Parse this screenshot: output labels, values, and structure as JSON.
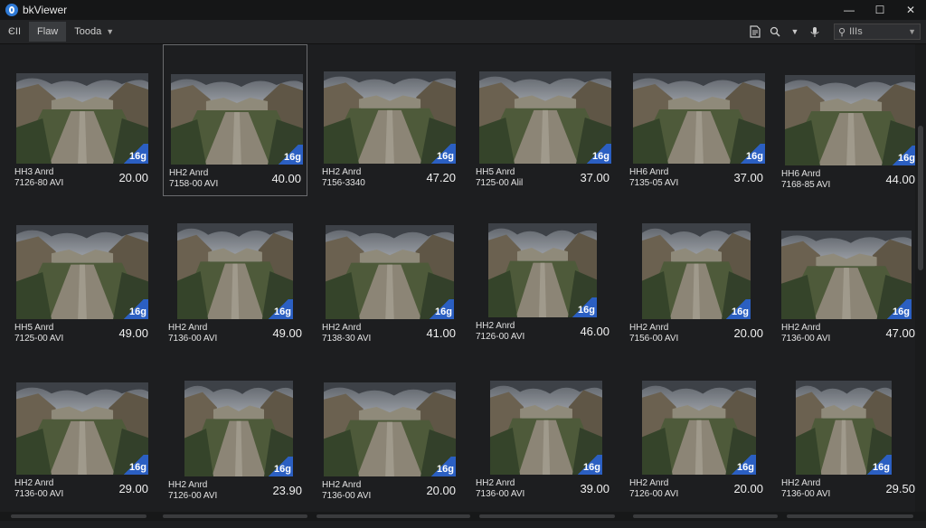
{
  "window": {
    "title": "bkViewer",
    "minimize": "—",
    "maximize": "☐",
    "close": "✕"
  },
  "toolbar": {
    "items": [
      "ЄІІ",
      "Flaw",
      "Tooda"
    ],
    "active_index": 1,
    "filter_label": "IIIs"
  },
  "icons": {
    "app": "app-logo-icon",
    "doc": "document-icon",
    "search": "search-icon",
    "mic": "microphone-icon",
    "filter": "filter-icon"
  },
  "accent_color": "#2b5fc2",
  "cards": [
    {
      "title": "HH3 Anrd",
      "time": "7126-80 AVI",
      "price": "20.00",
      "badge": "16g"
    },
    {
      "title": "HH2 Anrd",
      "time": "7158-00 AVI",
      "price": "40.00",
      "badge": "16g"
    },
    {
      "title": "HH2 Anrd",
      "time": "7156-3340",
      "price": "47.20",
      "badge": "16g"
    },
    {
      "title": "HH5 Anrd",
      "time": "7125-00 Alil",
      "price": "37.00",
      "badge": "16g"
    },
    {
      "title": "HH6 Anrd",
      "time": "7135-05 AVI",
      "price": "37.00",
      "badge": "16g"
    },
    {
      "title": "HH6 Anrd",
      "time": "7168-85 AVI",
      "price": "44.00",
      "badge": "16g"
    },
    {
      "title": "HH5 Anrd",
      "time": "7125-00 AVI",
      "price": "49.00",
      "badge": "16g"
    },
    {
      "title": "HH2 Anrd",
      "time": "7136-00 AVI",
      "price": "49.00",
      "badge": "16g"
    },
    {
      "title": "HH2 Anrd",
      "time": "7138-30 AVI",
      "price": "41.00",
      "badge": "16g"
    },
    {
      "title": "HH2 Anrd",
      "time": "7126-00 AVI",
      "price": "46.00",
      "badge": "16g"
    },
    {
      "title": "HH2 Anrd",
      "time": "7156-00 AVI",
      "price": "20.00",
      "badge": "16g"
    },
    {
      "title": "HH2 Anrd",
      "time": "7136-00 AVI",
      "price": "47.00",
      "badge": "16g"
    },
    {
      "title": "HH2 Anrd",
      "time": "7136-00 AVI",
      "price": "29.00",
      "badge": "16g"
    },
    {
      "title": "HH2 Anrd",
      "time": "7126-00 AVI",
      "price": "23.90",
      "badge": "16g"
    },
    {
      "title": "HH2 Anrd",
      "time": "7136-00 AVI",
      "price": "20.00",
      "badge": "16g"
    },
    {
      "title": "HH2 Anrd",
      "time": "7136-00 AVI",
      "price": "39.00",
      "badge": "16g"
    },
    {
      "title": "HH2 Anrd",
      "time": "7126-00 AVI",
      "price": "20.00",
      "badge": "16g"
    },
    {
      "title": "HH2 Anrd",
      "time": "7136-00 AVI",
      "price": "29.50",
      "badge": "16g"
    }
  ]
}
